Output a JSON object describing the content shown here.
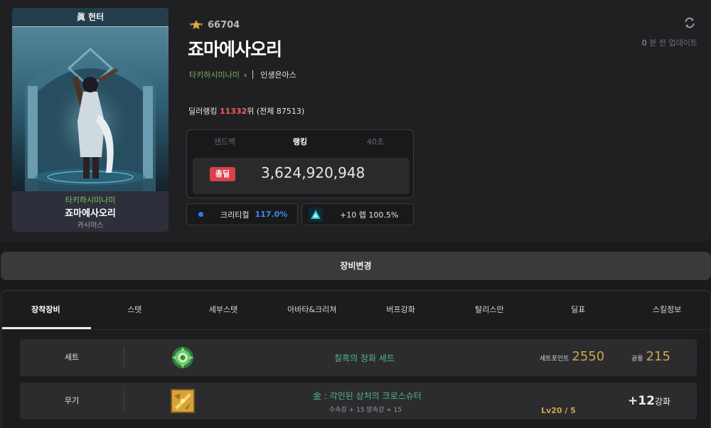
{
  "portrait": {
    "title": "眞 헌터",
    "guild": "타키하시미나미",
    "name": "죠마에사오리",
    "server": "카시야스"
  },
  "adventure": {
    "fame": "66704"
  },
  "character": {
    "name": "죠마에사오리",
    "guild": "타키하시미나미",
    "job": "인생은아스"
  },
  "update": {
    "minutes": "0",
    "label": "분 전 업데이트"
  },
  "dealer_rank": {
    "prefix": "딜러랭킹",
    "rank": "11332",
    "suffix": "위 (전체 87513)"
  },
  "damage": {
    "tabs": [
      "샌드백",
      "랭킹",
      "40초"
    ],
    "active_tab": 1,
    "badge": "총딜",
    "value": "3,624,920,948"
  },
  "stats": {
    "crit_label": "크리티컬",
    "crit_value": "117.0%",
    "enhance_text": "+10 렙 100.5%"
  },
  "equip_change_label": "장비변경",
  "tabs": [
    "장착장비",
    "스탯",
    "세부스탯",
    "아바타&크리쳐",
    "버프강화",
    "탈리스만",
    "딜표",
    "스킬정보"
  ],
  "equipment": {
    "set": {
      "category": "세트",
      "name": "칠흑의 정화 세트",
      "point_label": "세트포인트",
      "point_value": "2550",
      "common_label": "공용",
      "common_value": "215"
    },
    "weapon": {
      "category": "무기",
      "name": "金 : 각인된 상처의 크로스슈터",
      "sub": "수속강 + 15 암속강 + 15",
      "level": "Lv20 / 5",
      "enhance_value": "+12",
      "enhance_label": "강화"
    }
  },
  "colors": {
    "accent_red": "#ef5f59",
    "badge_red": "#d9424c",
    "crit_blue": "#3a8df0",
    "guild_green": "#77b05a",
    "item_green": "#4fb592",
    "gold": "#cda74b"
  },
  "icons": {
    "fame": "rank-medal-icon",
    "refresh": "refresh-icon",
    "crit": "crit-dot-icon",
    "enhance": "skill-gem-icon",
    "set": "rose-emblem-icon",
    "weapon": "crossbow-item-icon"
  }
}
